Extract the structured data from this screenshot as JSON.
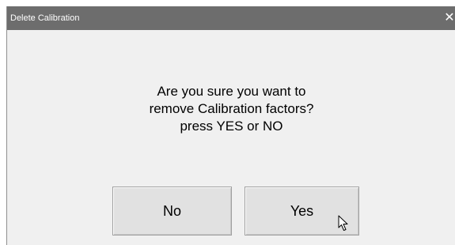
{
  "window": {
    "title": "Delete Calibration",
    "close_glyph": "✕"
  },
  "message": {
    "line1": "Are you sure you want to",
    "line2": "remove Calibration factors?",
    "line3": "press  YES  or  NO"
  },
  "buttons": {
    "no_label": "No",
    "yes_label": "Yes"
  },
  "icons": {
    "close": "close-icon",
    "cursor": "mouse-pointer-icon"
  },
  "colors": {
    "titlebar": "#6d6d6d",
    "dialog_bg": "#f0f0f0",
    "button_bg": "#e1e1e1"
  }
}
